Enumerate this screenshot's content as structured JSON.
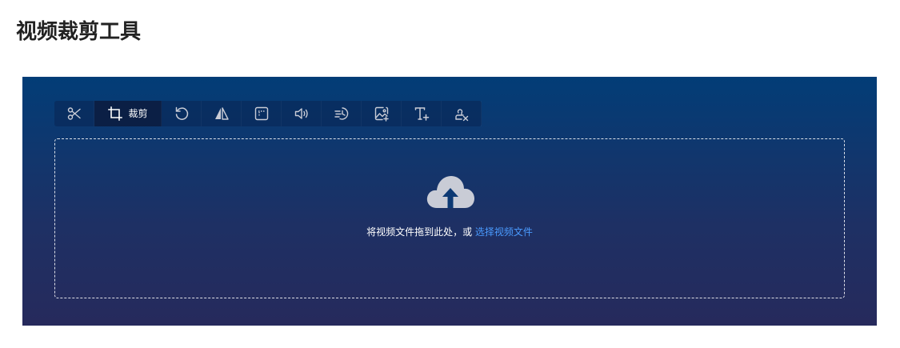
{
  "page": {
    "title": "视频裁剪工具"
  },
  "toolbar": {
    "items": [
      {
        "icon": "scissors-icon"
      },
      {
        "icon": "crop-icon",
        "label": "裁剪",
        "active": true
      },
      {
        "icon": "rotate-icon"
      },
      {
        "icon": "flip-icon"
      },
      {
        "icon": "frame-icon"
      },
      {
        "icon": "volume-icon"
      },
      {
        "icon": "speed-icon"
      },
      {
        "icon": "add-image-icon"
      },
      {
        "icon": "add-text-icon"
      },
      {
        "icon": "remove-watermark-icon"
      }
    ]
  },
  "dropzone": {
    "icon": "cloud-upload-icon",
    "text": "将视频文件拖到此处，或",
    "link": "选择视频文件"
  },
  "colors": {
    "panel_top": "#023d77",
    "panel_bottom": "#262a5c",
    "link": "#4a9bff",
    "icon": "#c9ccd6"
  }
}
